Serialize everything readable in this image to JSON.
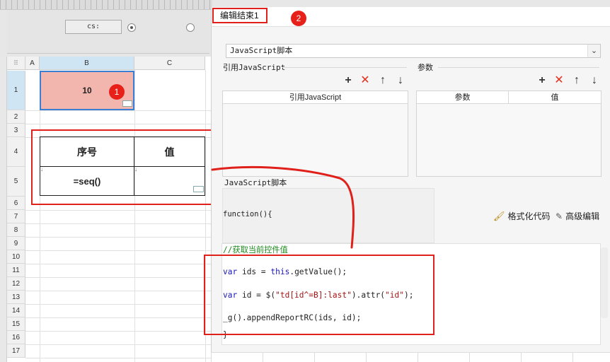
{
  "designer": {
    "control_label": "cs:"
  },
  "sheet": {
    "columns": [
      "A",
      "B",
      "C"
    ],
    "rows": [
      "1",
      "2",
      "3",
      "4",
      "5",
      "6",
      "7",
      "8",
      "9",
      "10",
      "11",
      "12",
      "13",
      "14",
      "15",
      "16",
      "17"
    ],
    "cell_b1": "10",
    "table_header": [
      "序号",
      "值"
    ],
    "table_row": [
      "=seq()",
      ""
    ]
  },
  "annotations": {
    "badge1": "1",
    "badge2": "2"
  },
  "dialog": {
    "title": "编辑结束1",
    "script_type": "JavaScript脚本",
    "ref_section_label": "引用JavaScript",
    "param_section_label": "参数",
    "ref_list_header": "引用JavaScript",
    "param_list_headers": [
      "参数",
      "值"
    ],
    "script_section_label": "JavaScript脚本",
    "function_signature": "function(){",
    "format_code_label": "格式化代码",
    "advanced_edit_label": "高级编辑",
    "code": {
      "comment": "//获取当前控件值",
      "line1_kw": "var",
      "line1_a": " ids = ",
      "line1_kw2": "this",
      "line1_b": ".getValue();",
      "line2_kw": "var",
      "line2_a": " id = $(",
      "line2_str1": "\"td[id^=B]:last\"",
      "line2_b": ").attr(",
      "line2_str2": "\"id\"",
      "line2_c": ");",
      "line3": "_g().appendReportRC(ids, id);",
      "closing": "}"
    }
  },
  "colors": {
    "accent_red": "#e8201a",
    "selection_blue": "#3b7fd4",
    "cell_fill": "#f2b6ae"
  }
}
